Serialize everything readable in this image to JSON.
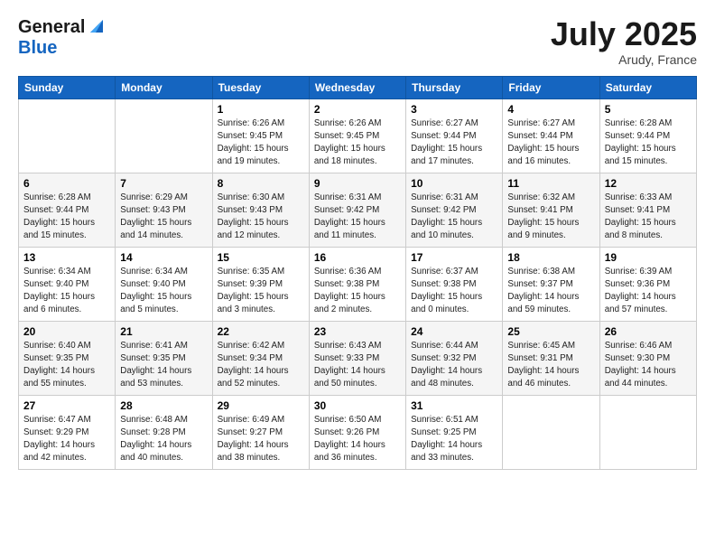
{
  "header": {
    "logo_line1": "General",
    "logo_line2": "Blue",
    "month": "July 2025",
    "location": "Arudy, France"
  },
  "weekdays": [
    "Sunday",
    "Monday",
    "Tuesday",
    "Wednesday",
    "Thursday",
    "Friday",
    "Saturday"
  ],
  "weeks": [
    [
      {
        "day": "",
        "sunrise": "",
        "sunset": "",
        "daylight": ""
      },
      {
        "day": "",
        "sunrise": "",
        "sunset": "",
        "daylight": ""
      },
      {
        "day": "1",
        "sunrise": "Sunrise: 6:26 AM",
        "sunset": "Sunset: 9:45 PM",
        "daylight": "Daylight: 15 hours and 19 minutes."
      },
      {
        "day": "2",
        "sunrise": "Sunrise: 6:26 AM",
        "sunset": "Sunset: 9:45 PM",
        "daylight": "Daylight: 15 hours and 18 minutes."
      },
      {
        "day": "3",
        "sunrise": "Sunrise: 6:27 AM",
        "sunset": "Sunset: 9:44 PM",
        "daylight": "Daylight: 15 hours and 17 minutes."
      },
      {
        "day": "4",
        "sunrise": "Sunrise: 6:27 AM",
        "sunset": "Sunset: 9:44 PM",
        "daylight": "Daylight: 15 hours and 16 minutes."
      },
      {
        "day": "5",
        "sunrise": "Sunrise: 6:28 AM",
        "sunset": "Sunset: 9:44 PM",
        "daylight": "Daylight: 15 hours and 15 minutes."
      }
    ],
    [
      {
        "day": "6",
        "sunrise": "Sunrise: 6:28 AM",
        "sunset": "Sunset: 9:44 PM",
        "daylight": "Daylight: 15 hours and 15 minutes."
      },
      {
        "day": "7",
        "sunrise": "Sunrise: 6:29 AM",
        "sunset": "Sunset: 9:43 PM",
        "daylight": "Daylight: 15 hours and 14 minutes."
      },
      {
        "day": "8",
        "sunrise": "Sunrise: 6:30 AM",
        "sunset": "Sunset: 9:43 PM",
        "daylight": "Daylight: 15 hours and 12 minutes."
      },
      {
        "day": "9",
        "sunrise": "Sunrise: 6:31 AM",
        "sunset": "Sunset: 9:42 PM",
        "daylight": "Daylight: 15 hours and 11 minutes."
      },
      {
        "day": "10",
        "sunrise": "Sunrise: 6:31 AM",
        "sunset": "Sunset: 9:42 PM",
        "daylight": "Daylight: 15 hours and 10 minutes."
      },
      {
        "day": "11",
        "sunrise": "Sunrise: 6:32 AM",
        "sunset": "Sunset: 9:41 PM",
        "daylight": "Daylight: 15 hours and 9 minutes."
      },
      {
        "day": "12",
        "sunrise": "Sunrise: 6:33 AM",
        "sunset": "Sunset: 9:41 PM",
        "daylight": "Daylight: 15 hours and 8 minutes."
      }
    ],
    [
      {
        "day": "13",
        "sunrise": "Sunrise: 6:34 AM",
        "sunset": "Sunset: 9:40 PM",
        "daylight": "Daylight: 15 hours and 6 minutes."
      },
      {
        "day": "14",
        "sunrise": "Sunrise: 6:34 AM",
        "sunset": "Sunset: 9:40 PM",
        "daylight": "Daylight: 15 hours and 5 minutes."
      },
      {
        "day": "15",
        "sunrise": "Sunrise: 6:35 AM",
        "sunset": "Sunset: 9:39 PM",
        "daylight": "Daylight: 15 hours and 3 minutes."
      },
      {
        "day": "16",
        "sunrise": "Sunrise: 6:36 AM",
        "sunset": "Sunset: 9:38 PM",
        "daylight": "Daylight: 15 hours and 2 minutes."
      },
      {
        "day": "17",
        "sunrise": "Sunrise: 6:37 AM",
        "sunset": "Sunset: 9:38 PM",
        "daylight": "Daylight: 15 hours and 0 minutes."
      },
      {
        "day": "18",
        "sunrise": "Sunrise: 6:38 AM",
        "sunset": "Sunset: 9:37 PM",
        "daylight": "Daylight: 14 hours and 59 minutes."
      },
      {
        "day": "19",
        "sunrise": "Sunrise: 6:39 AM",
        "sunset": "Sunset: 9:36 PM",
        "daylight": "Daylight: 14 hours and 57 minutes."
      }
    ],
    [
      {
        "day": "20",
        "sunrise": "Sunrise: 6:40 AM",
        "sunset": "Sunset: 9:35 PM",
        "daylight": "Daylight: 14 hours and 55 minutes."
      },
      {
        "day": "21",
        "sunrise": "Sunrise: 6:41 AM",
        "sunset": "Sunset: 9:35 PM",
        "daylight": "Daylight: 14 hours and 53 minutes."
      },
      {
        "day": "22",
        "sunrise": "Sunrise: 6:42 AM",
        "sunset": "Sunset: 9:34 PM",
        "daylight": "Daylight: 14 hours and 52 minutes."
      },
      {
        "day": "23",
        "sunrise": "Sunrise: 6:43 AM",
        "sunset": "Sunset: 9:33 PM",
        "daylight": "Daylight: 14 hours and 50 minutes."
      },
      {
        "day": "24",
        "sunrise": "Sunrise: 6:44 AM",
        "sunset": "Sunset: 9:32 PM",
        "daylight": "Daylight: 14 hours and 48 minutes."
      },
      {
        "day": "25",
        "sunrise": "Sunrise: 6:45 AM",
        "sunset": "Sunset: 9:31 PM",
        "daylight": "Daylight: 14 hours and 46 minutes."
      },
      {
        "day": "26",
        "sunrise": "Sunrise: 6:46 AM",
        "sunset": "Sunset: 9:30 PM",
        "daylight": "Daylight: 14 hours and 44 minutes."
      }
    ],
    [
      {
        "day": "27",
        "sunrise": "Sunrise: 6:47 AM",
        "sunset": "Sunset: 9:29 PM",
        "daylight": "Daylight: 14 hours and 42 minutes."
      },
      {
        "day": "28",
        "sunrise": "Sunrise: 6:48 AM",
        "sunset": "Sunset: 9:28 PM",
        "daylight": "Daylight: 14 hours and 40 minutes."
      },
      {
        "day": "29",
        "sunrise": "Sunrise: 6:49 AM",
        "sunset": "Sunset: 9:27 PM",
        "daylight": "Daylight: 14 hours and 38 minutes."
      },
      {
        "day": "30",
        "sunrise": "Sunrise: 6:50 AM",
        "sunset": "Sunset: 9:26 PM",
        "daylight": "Daylight: 14 hours and 36 minutes."
      },
      {
        "day": "31",
        "sunrise": "Sunrise: 6:51 AM",
        "sunset": "Sunset: 9:25 PM",
        "daylight": "Daylight: 14 hours and 33 minutes."
      },
      {
        "day": "",
        "sunrise": "",
        "sunset": "",
        "daylight": ""
      },
      {
        "day": "",
        "sunrise": "",
        "sunset": "",
        "daylight": ""
      }
    ]
  ]
}
